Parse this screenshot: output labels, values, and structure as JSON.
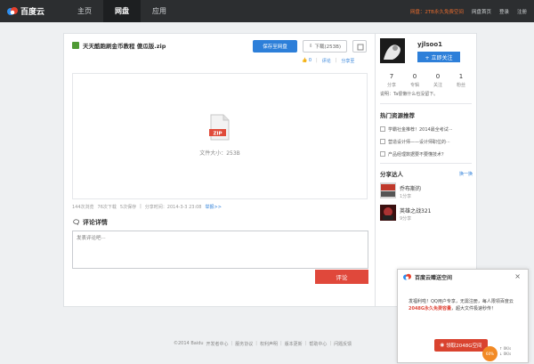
{
  "header": {
    "logo_text": "百度云",
    "nav": [
      "主页",
      "网盘",
      "应用"
    ],
    "active_nav": "网盘",
    "promo": "网盘：2TB永久免费空间",
    "links": [
      "网盘首页",
      "登录",
      "注册"
    ]
  },
  "file": {
    "name": "天天酷跑刷金币教程 傻瓜版.zip",
    "save_label": "保存至网盘",
    "download_label": "下载(253B)",
    "like_count": "0",
    "action_comment": "评论",
    "action_share": "分享至",
    "size_label": "文件大小：253B",
    "views": "144次浏览",
    "downloads": "76次下载",
    "saves": "5次保存",
    "share_time": "分享时间：2014-3-3 23:08",
    "report": "举报>>"
  },
  "comments": {
    "title": "评论详情",
    "placeholder": "发表评论吧···",
    "submit": "评论"
  },
  "user": {
    "name": "yjlsoo1",
    "follow_label": "+ 立即关注",
    "stats": [
      {
        "num": "7",
        "label": "分享"
      },
      {
        "num": "0",
        "label": "专辑"
      },
      {
        "num": "0",
        "label": "关注"
      },
      {
        "num": "1",
        "label": "粉丝"
      }
    ],
    "bio": "说明：Ta很懒什么也没留下。"
  },
  "hot": {
    "title": "热门资源推荐",
    "items": [
      "学霸社金推荐！2014最全考试···",
      "营造设计师——设计师职位的···",
      "产品经理数据要不要懂技术？"
    ]
  },
  "sharers": {
    "title": "分享达人",
    "next": "换一换",
    "items": [
      {
        "name": "乔布斯的",
        "count": "1分享"
      },
      {
        "name": "英雄之战321",
        "count": "9分享"
      }
    ]
  },
  "footer": {
    "items": [
      "©2014 Baidu",
      "开发者中心",
      "服务协议",
      "权利声明",
      "版本更新",
      "帮助中心",
      "问题反馈"
    ]
  },
  "popup": {
    "title": "百度云赠送空间",
    "close": "×",
    "text_a": "发福利啦！QQ用户专享，无需注册，每人限领百度云",
    "highlight": "2048G永久免费容量",
    "text_b": "，超大文件极速秒传！",
    "button": "领取2048G空间",
    "badge": "60%",
    "speed_up": "0K/s",
    "speed_down": "0K/s"
  },
  "colors": {
    "accent_blue": "#2d7fd9",
    "accent_red": "#e0483b",
    "topbar": "#2c2e30"
  }
}
